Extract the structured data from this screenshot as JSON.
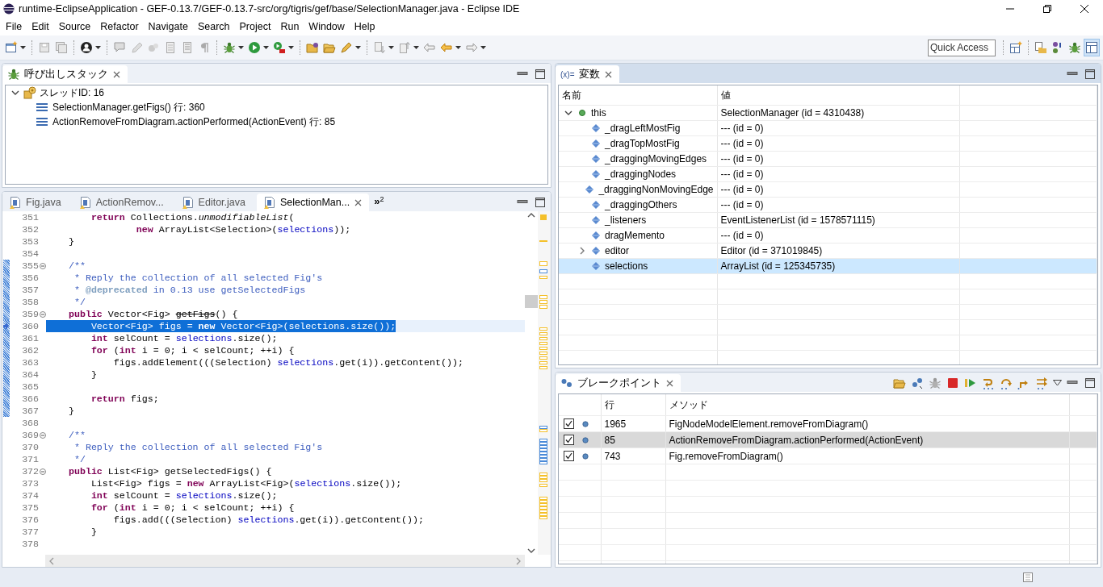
{
  "window": {
    "title": "runtime-EclipseApplication - GEF-0.13.7/GEF-0.13.7-src/org/tigris/gef/base/SelectionManager.java - Eclipse IDE"
  },
  "menu": [
    "File",
    "Edit",
    "Source",
    "Refactor",
    "Navigate",
    "Search",
    "Project",
    "Run",
    "Window",
    "Help"
  ],
  "quick_access": {
    "placeholder": "Quick Access"
  },
  "call_stack": {
    "title": "呼び出しスタック",
    "active": false,
    "threads": [
      {
        "label": "スレッドID: 16",
        "expanded": true,
        "children": [
          {
            "label": "SelectionManager.getFigs() 行: 360"
          },
          {
            "label": "ActionRemoveFromDiagram.actionPerformed(ActionEvent) 行: 85"
          }
        ]
      }
    ]
  },
  "editor": {
    "active": false,
    "tabs": [
      {
        "label": "Fig.java",
        "selected": false
      },
      {
        "label": "ActionRemov...",
        "selected": false
      },
      {
        "label": "Editor.java",
        "selected": false
      },
      {
        "label": "SelectionMan...",
        "selected": true
      }
    ],
    "overflow": {
      "chevron": "»",
      "count": "2"
    },
    "lines": [
      {
        "number": "351",
        "current": false,
        "selected": false,
        "changed": false,
        "foldable": false,
        "segments": [
          {
            "t": "        return",
            "kind": "kw"
          },
          {
            "t": " Collections.",
            "kind": "plain"
          },
          {
            "t": "unmodifiableList",
            "kind": "static"
          },
          {
            "t": "(",
            "kind": "plain"
          }
        ]
      },
      {
        "number": "352",
        "current": false,
        "selected": false,
        "changed": false,
        "foldable": false,
        "segments": [
          {
            "t": "                new",
            "kind": "kw"
          },
          {
            "t": " ArrayList<Selection>(",
            "kind": "plain"
          },
          {
            "t": "selections",
            "kind": "field"
          },
          {
            "t": "));",
            "kind": "plain"
          }
        ]
      },
      {
        "number": "353",
        "current": false,
        "selected": false,
        "changed": false,
        "foldable": false,
        "segments": [
          {
            "t": "    }",
            "kind": "plain"
          }
        ]
      },
      {
        "number": "354",
        "current": false,
        "changed": false,
        "foldable": false
      },
      {
        "number": "355",
        "current": false,
        "selected": false,
        "changed": true,
        "foldable": true,
        "segments": [
          {
            "t": "    /**",
            "kind": "comment"
          }
        ]
      },
      {
        "number": "356",
        "current": false,
        "selected": false,
        "changed": true,
        "foldable": false,
        "segments": [
          {
            "t": "     * Reply the collection of all selected Fig's",
            "kind": "comment"
          }
        ]
      },
      {
        "number": "357",
        "current": false,
        "selected": false,
        "changed": true,
        "foldable": false,
        "segments": [
          {
            "t": "     * ",
            "kind": "comment"
          },
          {
            "t": "@deprecated",
            "kind": "doctag"
          },
          {
            "t": " in 0.13 use getSelectedFigs",
            "kind": "comment"
          }
        ]
      },
      {
        "number": "358",
        "current": false,
        "selected": false,
        "changed": true,
        "foldable": false,
        "segments": [
          {
            "t": "     */",
            "kind": "comment"
          }
        ]
      },
      {
        "number": "359",
        "current": false,
        "selected": false,
        "changed": true,
        "foldable": true,
        "segments": [
          {
            "t": "    public",
            "kind": "kw"
          },
          {
            "t": " Vector<Fig> ",
            "kind": "plain"
          },
          {
            "t": "getFigs",
            "kind": "deprecated"
          },
          {
            "t": "() {",
            "kind": "plain"
          }
        ]
      },
      {
        "number": "360",
        "current": true,
        "selected": true,
        "changed": true,
        "foldable": false,
        "segments": [
          {
            "t": "        Vector<Fig> figs = ",
            "kind": "plain"
          },
          {
            "t": "new",
            "kind": "kw"
          },
          {
            "t": " Vector<Fig>(",
            "kind": "plain"
          },
          {
            "t": "selections",
            "kind": "field"
          },
          {
            "t": ".size());",
            "kind": "plain"
          }
        ]
      },
      {
        "number": "361",
        "current": false,
        "selected": false,
        "changed": true,
        "foldable": false,
        "segments": [
          {
            "t": "        int",
            "kind": "kw"
          },
          {
            "t": " selCount = ",
            "kind": "plain"
          },
          {
            "t": "selections",
            "kind": "field"
          },
          {
            "t": ".size();",
            "kind": "plain"
          }
        ]
      },
      {
        "number": "362",
        "current": false,
        "selected": false,
        "changed": true,
        "foldable": false,
        "segments": [
          {
            "t": "        for",
            "kind": "kw"
          },
          {
            "t": " (",
            "kind": "plain"
          },
          {
            "t": "int",
            "kind": "kw"
          },
          {
            "t": " i = 0; i < selCount; ++i) {",
            "kind": "plain"
          }
        ]
      },
      {
        "number": "363",
        "current": false,
        "selected": false,
        "changed": true,
        "foldable": false,
        "segments": [
          {
            "t": "            figs.addElement(((Selection) ",
            "kind": "plain"
          },
          {
            "t": "selections",
            "kind": "field"
          },
          {
            "t": ".get(i)).getContent());",
            "kind": "plain"
          }
        ]
      },
      {
        "number": "364",
        "current": false,
        "selected": false,
        "changed": true,
        "foldable": false,
        "segments": [
          {
            "t": "        }",
            "kind": "plain"
          }
        ]
      },
      {
        "number": "365",
        "current": false,
        "changed": true,
        "foldable": false
      },
      {
        "number": "366",
        "current": false,
        "selected": false,
        "changed": true,
        "foldable": false,
        "segments": [
          {
            "t": "        return",
            "kind": "kw"
          },
          {
            "t": " figs;",
            "kind": "plain"
          }
        ]
      },
      {
        "number": "367",
        "current": false,
        "selected": false,
        "changed": true,
        "foldable": false,
        "segments": [
          {
            "t": "    }",
            "kind": "plain"
          }
        ]
      },
      {
        "number": "368",
        "current": false,
        "changed": false,
        "foldable": false
      },
      {
        "number": "369",
        "current": false,
        "selected": false,
        "changed": false,
        "foldable": true,
        "segments": [
          {
            "t": "    /**",
            "kind": "comment"
          }
        ]
      },
      {
        "number": "370",
        "current": false,
        "selected": false,
        "changed": false,
        "foldable": false,
        "segments": [
          {
            "t": "     * Reply the collection of all selected Fig's",
            "kind": "comment"
          }
        ]
      },
      {
        "number": "371",
        "current": false,
        "selected": false,
        "changed": false,
        "foldable": false,
        "segments": [
          {
            "t": "     */",
            "kind": "comment"
          }
        ]
      },
      {
        "number": "372",
        "current": false,
        "selected": false,
        "changed": false,
        "foldable": true,
        "segments": [
          {
            "t": "    public",
            "kind": "kw"
          },
          {
            "t": " List<Fig> getSelectedFigs() {",
            "kind": "plain"
          }
        ]
      },
      {
        "number": "373",
        "current": false,
        "selected": false,
        "changed": false,
        "foldable": false,
        "segments": [
          {
            "t": "        List<Fig> figs = ",
            "kind": "plain"
          },
          {
            "t": "new",
            "kind": "kw"
          },
          {
            "t": " ArrayList<Fig>(",
            "kind": "plain"
          },
          {
            "t": "selections",
            "kind": "field"
          },
          {
            "t": ".size());",
            "kind": "plain"
          }
        ]
      },
      {
        "number": "374",
        "current": false,
        "selected": false,
        "changed": false,
        "foldable": false,
        "segments": [
          {
            "t": "        int",
            "kind": "kw"
          },
          {
            "t": " selCount = ",
            "kind": "plain"
          },
          {
            "t": "selections",
            "kind": "field"
          },
          {
            "t": ".size();",
            "kind": "plain"
          }
        ]
      },
      {
        "number": "375",
        "current": false,
        "selected": false,
        "changed": false,
        "foldable": false,
        "segments": [
          {
            "t": "        for",
            "kind": "kw"
          },
          {
            "t": " (",
            "kind": "plain"
          },
          {
            "t": "int",
            "kind": "kw"
          },
          {
            "t": " i = 0; i < selCount; ++i) {",
            "kind": "plain"
          }
        ]
      },
      {
        "number": "376",
        "current": false,
        "selected": false,
        "changed": false,
        "foldable": false,
        "segments": [
          {
            "t": "            figs.add(((Selection) ",
            "kind": "plain"
          },
          {
            "t": "selections",
            "kind": "field"
          },
          {
            "t": ".get(i)).getContent());",
            "kind": "plain"
          }
        ]
      },
      {
        "number": "377",
        "current": false,
        "selected": false,
        "changed": false,
        "foldable": false,
        "segments": [
          {
            "t": "        }",
            "kind": "plain"
          }
        ]
      },
      {
        "number": "378",
        "current": false,
        "changed": false,
        "foldable": false
      }
    ]
  },
  "variables": {
    "title": "変数",
    "icon_label": "(x)=",
    "active": true,
    "columns": [
      "名前",
      "値"
    ],
    "rows": [
      {
        "name": "this",
        "value": "SelectionManager (id = 4310438)",
        "kind": "local",
        "expanded": true,
        "selected": false,
        "children": [
          {
            "name": "_dragLeftMostFig",
            "value": "--- (id = 0)",
            "kind": "field",
            "selected": false
          },
          {
            "name": "_dragTopMostFig",
            "value": "--- (id = 0)",
            "kind": "field",
            "selected": false
          },
          {
            "name": "_draggingMovingEdges",
            "value": "--- (id = 0)",
            "kind": "field",
            "selected": false
          },
          {
            "name": "_draggingNodes",
            "value": "--- (id = 0)",
            "kind": "field",
            "selected": false
          },
          {
            "name": "_draggingNonMovingEdge",
            "value": "--- (id = 0)",
            "kind": "field",
            "selected": false
          },
          {
            "name": "_draggingOthers",
            "value": "--- (id = 0)",
            "kind": "field",
            "selected": false
          },
          {
            "name": "_listeners",
            "value": "EventListenerList (id = 1578571115)",
            "kind": "field",
            "selected": false
          },
          {
            "name": "dragMemento",
            "value": "--- (id = 0)",
            "kind": "field",
            "selected": false
          },
          {
            "name": "editor",
            "value": "Editor (id = 371019845)",
            "kind": "field",
            "expanded": false,
            "selected": false
          },
          {
            "name": "selections",
            "value": "ArrayList (id = 125345735)",
            "kind": "field",
            "selected": true
          }
        ]
      }
    ]
  },
  "breakpoints": {
    "title": "ブレークポイント",
    "active": false,
    "columns": [
      "行",
      "メソッド"
    ],
    "rows": [
      {
        "checked": true,
        "line": "1965",
        "method": "FigNodeModelElement.removeFromDiagram()",
        "selected": false
      },
      {
        "checked": true,
        "line": "85",
        "method": "ActionRemoveFromDiagram.actionPerformed(ActionEvent)",
        "selected": true
      },
      {
        "checked": true,
        "line": "743",
        "method": "Fig.removeFromDiagram()",
        "selected": false
      }
    ]
  }
}
